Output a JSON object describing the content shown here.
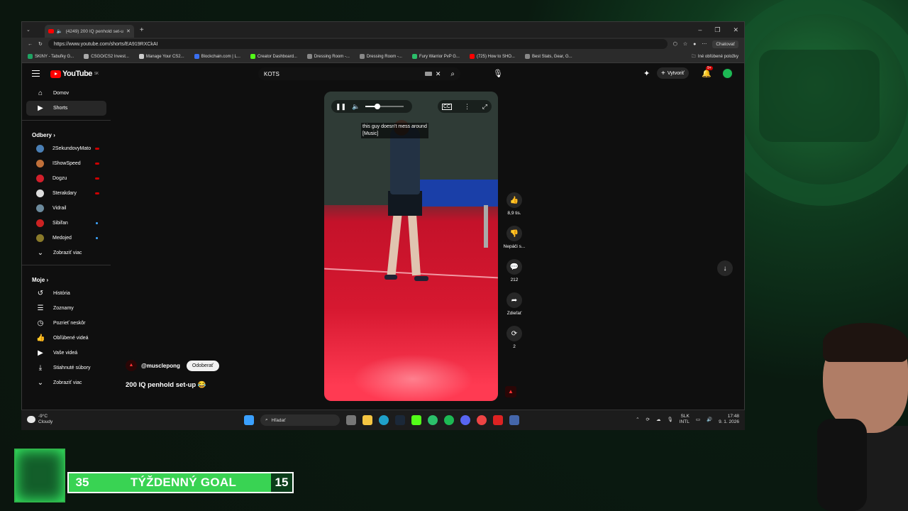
{
  "browser": {
    "tab_title": "(4249) 200 IQ penhold set-up",
    "url": "https://www.youtube.com/shorts/EA919RXCkAI",
    "chat_button": "Chatovať",
    "bookmarks": [
      {
        "label": "SKINY - Tabuľky G...",
        "color": "#1ea362"
      },
      {
        "label": "CSGO/CS2 Invest...",
        "color": "#aaaaaa"
      },
      {
        "label": "Manage Your CS2...",
        "color": "#cccccc"
      },
      {
        "label": "Blockchain.com | L...",
        "color": "#3a6ff0"
      },
      {
        "label": "Creator Dashboard...",
        "color": "#53fc18"
      },
      {
        "label": "Dressing Room -...",
        "color": "#888888"
      },
      {
        "label": "Dressing Room -...",
        "color": "#888888"
      },
      {
        "label": "Fury Warrior PvP G...",
        "color": "#2bbf6a"
      },
      {
        "label": "(725) How to SHO...",
        "color": "#ff0000"
      },
      {
        "label": "Best Stats, Gear, G...",
        "color": "#888888"
      }
    ],
    "other_bookmarks": "Iné obľúbené položky"
  },
  "youtube": {
    "logo_text": "YouTube",
    "logo_region": "SK",
    "search_value": "KOTS",
    "create_label": "Vytvoriť",
    "notif_count": "9+",
    "nav": [
      {
        "label": "Domov",
        "icon": "home-icon",
        "glyph": "⌂"
      },
      {
        "label": "Shorts",
        "icon": "shorts-icon",
        "glyph": "▶"
      }
    ],
    "subs_title": "Odbery",
    "subscriptions": [
      {
        "label": "2SekundovyMato",
        "color": "#4a7fb5",
        "live": true
      },
      {
        "label": "IShowSpeed",
        "color": "#c0703a",
        "live": true
      },
      {
        "label": "Dogzu",
        "color": "#d21f2b",
        "live": true
      },
      {
        "label": "Sterakdary",
        "color": "#dddddd",
        "live": true
      },
      {
        "label": "Vidrail",
        "color": "#6c8a9c",
        "live": false
      },
      {
        "label": "Sibiřan",
        "color": "#cc2222",
        "live": false,
        "new": true
      },
      {
        "label": "Medojed",
        "color": "#8a7a2a",
        "live": false,
        "new": true
      }
    ],
    "show_more": "Zobraziť viac",
    "mine_title": "Moje",
    "mine": [
      {
        "label": "História",
        "glyph": "↺"
      },
      {
        "label": "Zoznamy",
        "glyph": "☰"
      },
      {
        "label": "Pozrieť neskôr",
        "glyph": "◷"
      },
      {
        "label": "Obľúbené videá",
        "glyph": "👍"
      },
      {
        "label": "Vaše videá",
        "glyph": "▶"
      },
      {
        "label": "Stiahnuté súbory",
        "glyph": "⤓"
      }
    ],
    "show_more_2": "Zobraziť viac",
    "short": {
      "caption": "this guy doesn't mess around\n[Music]",
      "channel": "@musclepong",
      "subscribe_label": "Odoberať",
      "title": "200 IQ penhold set-up 😂",
      "volume_fraction": 0.3
    },
    "actions": [
      {
        "name": "like",
        "glyph": "👍",
        "label": "8,9 tis."
      },
      {
        "name": "dislike",
        "glyph": "👎",
        "label": "Nepáči s..."
      },
      {
        "name": "comments",
        "glyph": "💬",
        "label": "212"
      },
      {
        "name": "share",
        "glyph": "➦",
        "label": "Zdieľať"
      },
      {
        "name": "remix",
        "glyph": "⟳",
        "label": "2"
      }
    ]
  },
  "taskbar": {
    "temp": "-9°C",
    "weather": "Cloudy",
    "search_label": "Hľadať",
    "lang": "SLK",
    "layout": "INTL",
    "time": "17:48",
    "date": "9. 1. 2026"
  },
  "overlay": {
    "goal_current": "35",
    "goal_label": "TÝŽDENNÝ GOAL",
    "goal_target": "15"
  }
}
